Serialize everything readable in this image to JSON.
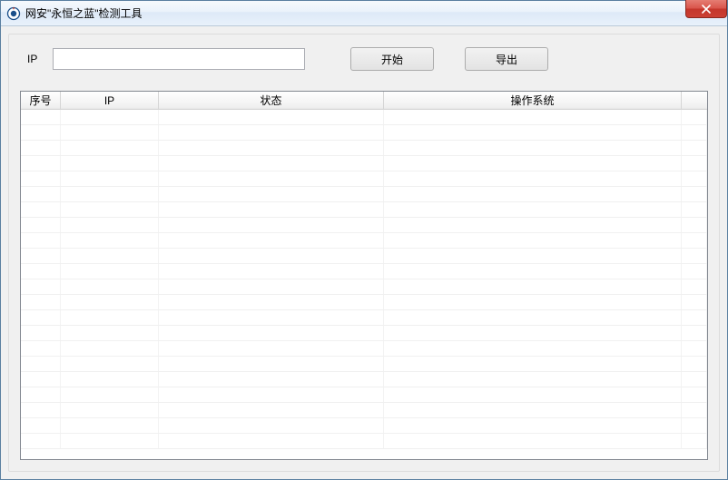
{
  "window": {
    "title": "网安\"永恒之蓝\"检测工具"
  },
  "toolbar": {
    "ip_label": "IP",
    "ip_value": "",
    "start_label": "开始",
    "export_label": "导出"
  },
  "table": {
    "columns": {
      "seq": "序号",
      "ip": "IP",
      "status": "状态",
      "os": "操作系统"
    },
    "rows": []
  }
}
